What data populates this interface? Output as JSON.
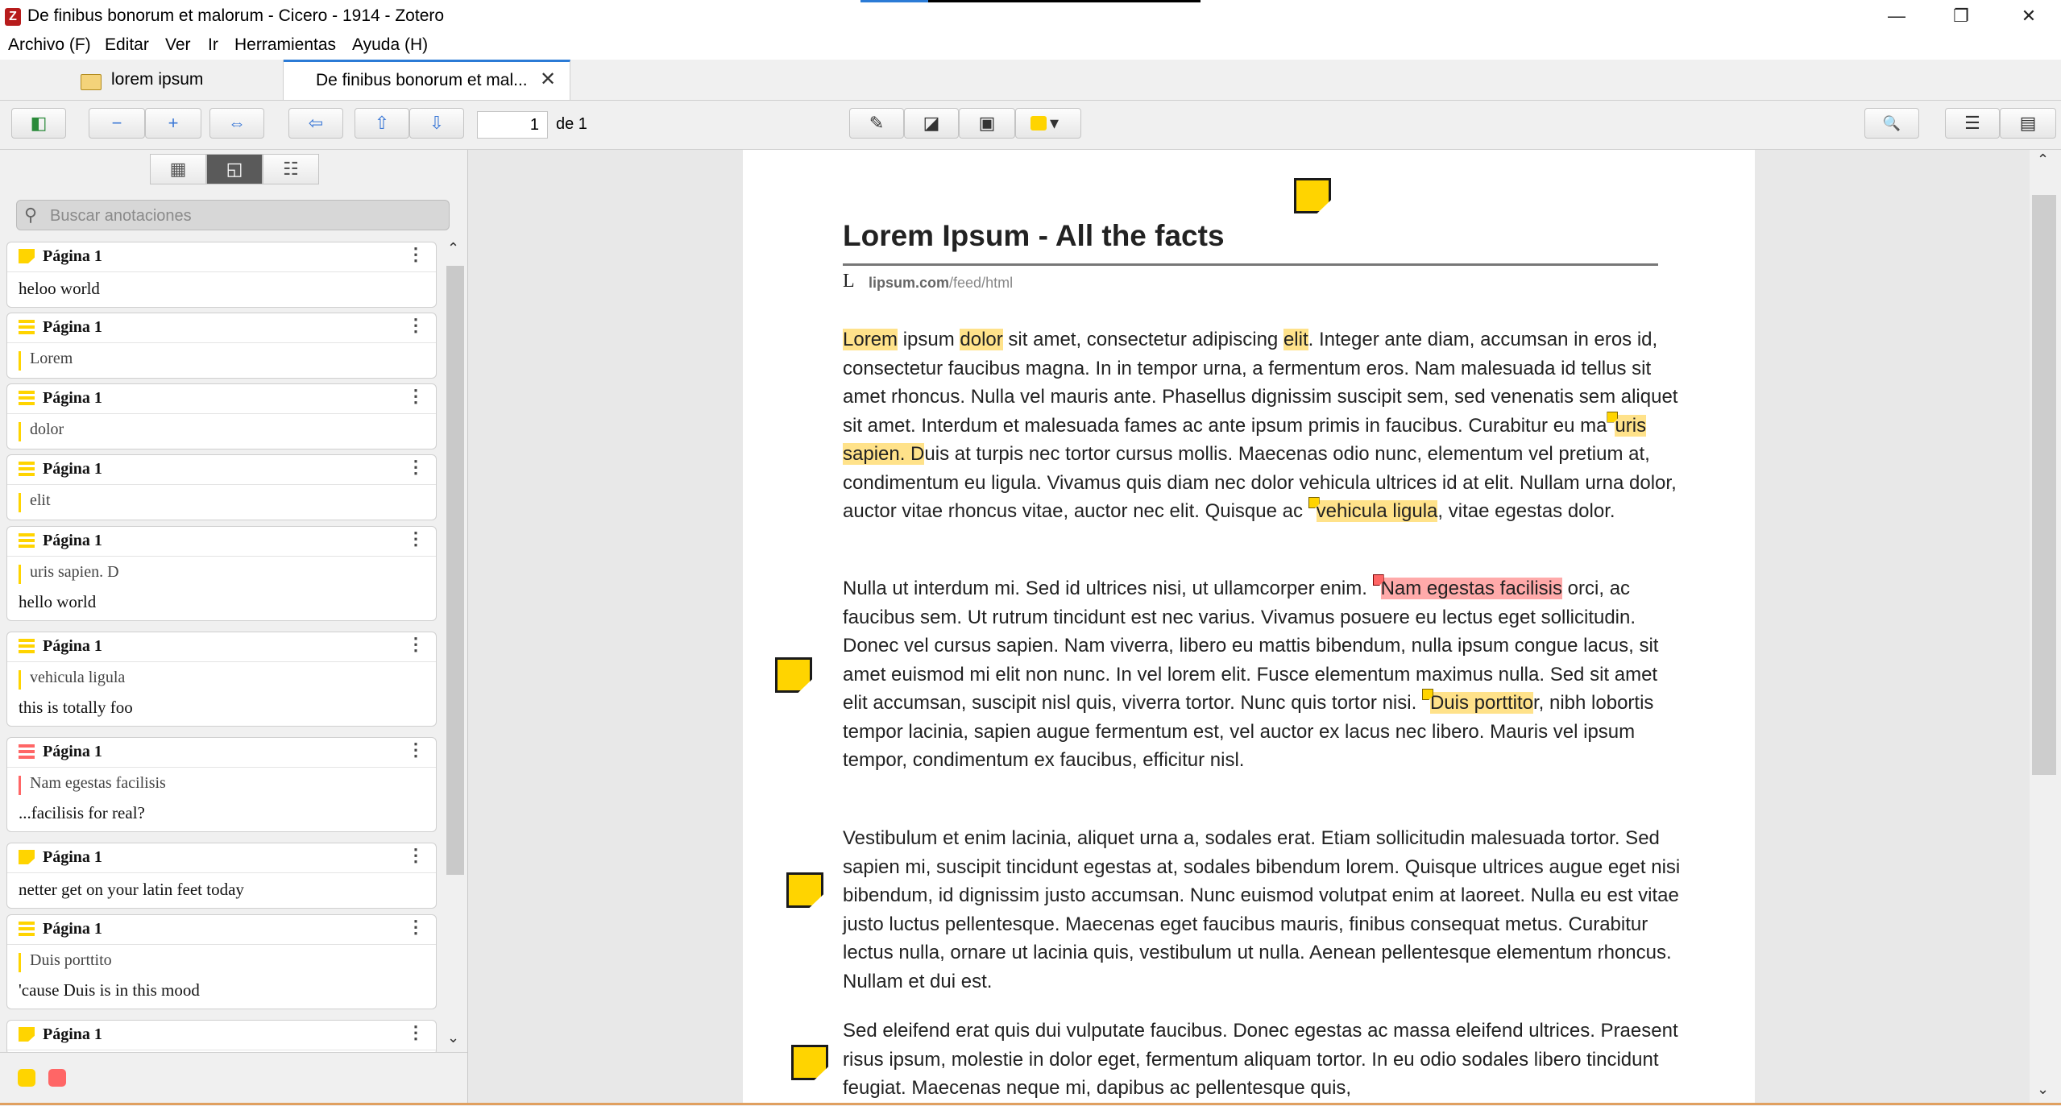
{
  "window": {
    "title": "De finibus bonorum et malorum - Cicero - 1914 - Zotero",
    "app_icon_letter": "Z",
    "minimize_glyph": "—",
    "restore_glyph": "❐",
    "close_glyph": "✕"
  },
  "menu": [
    "Archivo (F)",
    "Editar",
    "Ver",
    "Ir",
    "Herramientas",
    "Ayuda (H)"
  ],
  "tabs": {
    "library_label": "lorem ipsum",
    "reader_label": "De finibus bonorum et mal...",
    "close_glyph": "✕"
  },
  "toolbar": {
    "sidebar_toggle_glyph": "◧",
    "zoom_out_glyph": "−",
    "zoom_in_glyph": "+",
    "fit_width_glyph": "⇔",
    "back_glyph": "⇦",
    "prev_page_glyph": "⇧",
    "next_page_glyph": "⇩",
    "page_value": "1",
    "page_of": "de 1",
    "highlight_glyph": "✎",
    "note_glyph": "◪",
    "area_glyph": "▣",
    "color_dropdown_glyph": "▾",
    "find_glyph": "🔍",
    "outline_glyph": "☰",
    "notes_glyph": "▤",
    "accent_color": "#ffd400"
  },
  "sidebar": {
    "view_buttons": [
      "▦",
      "◱",
      "☷"
    ],
    "search_placeholder": "Buscar anotaciones",
    "search_glyph": "⚲",
    "more_glyph": "⋮",
    "annotations": [
      {
        "type": "note",
        "color": "#ffd400",
        "page": "Página 1",
        "text": "",
        "comment": "heloo world"
      },
      {
        "type": "highlight",
        "color": "#ffd400",
        "page": "Página 1",
        "text": "Lorem",
        "comment": ""
      },
      {
        "type": "highlight",
        "color": "#ffd400",
        "page": "Página 1",
        "text": "dolor",
        "comment": ""
      },
      {
        "type": "highlight",
        "color": "#ffd400",
        "page": "Página 1",
        "text": "elit",
        "comment": ""
      },
      {
        "type": "highlight",
        "color": "#ffd400",
        "page": "Página 1",
        "text": "uris sapien. D",
        "comment": "hello world"
      },
      {
        "type": "highlight",
        "color": "#ffd400",
        "page": "Página 1",
        "text": "vehicula ligula",
        "comment": "this is totally foo"
      },
      {
        "type": "highlight",
        "color": "#ff6666",
        "page": "Página 1",
        "text": "Nam egestas facilisis",
        "comment": "...facilisis for real?"
      },
      {
        "type": "note",
        "color": "#ffd400",
        "page": "Página 1",
        "text": "",
        "comment": "netter get on your latin feet today"
      },
      {
        "type": "highlight",
        "color": "#ffd400",
        "page": "Página 1",
        "text": "Duis porttito",
        "comment": "'cause Duis is in this mood"
      },
      {
        "type": "note",
        "color": "#ffd400",
        "page": "Página 1",
        "text": "",
        "comment": ""
      }
    ],
    "filter_colors": [
      "#ffd400",
      "#ff6666"
    ],
    "scroll_up_glyph": "⌃",
    "scroll_down_glyph": "⌄"
  },
  "document": {
    "title": "Lorem Ipsum - All the facts",
    "source_mark": "L",
    "source_domain": "lipsum.com",
    "source_path": "/feed/html",
    "p1": {
      "h_lorem": "Lorem",
      "t1": " ipsum ",
      "h_dolor": "dolor",
      "t2": " sit amet, consectetur adipiscing ",
      "h_elit": "elit",
      "t3": ". Integer ante diam, accumsan in eros id, consectetur faucibus magna. In in tempor urna, a fermentum eros. Nam malesuada id tellus sit amet rhoncus. Nulla vel mauris ante. Phasellus dignissim suscipit sem, sed venenatis sem aliquet sit amet. Interdum et malesuada fames ac ante ipsum primis in faucibus. Curabitur eu ma",
      "h_uris": "uris sapien. D",
      "t4": "uis at turpis nec tortor cursus mollis. Maecenas odio nunc, elementum vel pretium at, condimentum eu ligula. Vivamus quis diam nec dolor vehicula ultrices id at elit. Nullam urna dolor, auctor vitae rhoncus vitae, auctor nec elit. Quisque ac ",
      "h_vehicula": "vehicula ligula",
      "t5": ", vitae egestas dolor."
    },
    "p2": {
      "t1": "Nulla ut interdum mi. Sed id ultrices nisi, ut ullamcorper enim. ",
      "h_nam": "Nam egestas facilisis",
      "t2": " orci, ac faucibus sem. Ut rutrum tincidunt est nec varius. Vivamus posuere eu lectus eget sollicitudin. Donec vel cursus sapien. Nam viverra, libero eu mattis bibendum, nulla ipsum congue lacus, sit amet euismod mi elit non nunc. In vel lorem elit. Fusce elementum maximus nulla. Sed sit amet elit accumsan, suscipit nisl quis, viverra tortor. Nunc quis tortor nisi. ",
      "h_duis": "Duis porttito",
      "t3": "r, nibh lobortis tempor lacinia, sapien augue fermentum est, vel auctor ex lacus nec libero. Mauris vel ipsum tempor, condimentum ex faucibus, efficitur nisl."
    },
    "p3": "Vestibulum et enim lacinia, aliquet urna a, sodales erat. Etiam sollicitudin malesuada tortor. Sed sapien mi, suscipit tincidunt egestas at, sodales bibendum lorem. Quisque ultrices augue eget nisi bibendum, id dignissim justo accumsan. Nunc euismod volutpat enim at laoreet. Nulla eu est vitae justo luctus pellentesque. Maecenas eget faucibus mauris, finibus consequat metus. Curabitur lectus nulla, ornare ut lacinia quis, vestibulum ut nulla. Aenean pellentesque elementum rhoncus. Nullam et dui est.",
    "p4": "Sed eleifend erat quis dui vulputate faucibus. Donec egestas ac massa eleifend ultrices. Praesent risus ipsum, molestie in dolor eget, fermentum aliquam tortor. In eu odio sodales libero tincidunt feugiat. Maecenas neque mi, dapibus ac pellentesque quis,",
    "highlight_color": "#ffe28a",
    "red_highlight_color": "#ffaaaa"
  },
  "doc_scroll": {
    "up_glyph": "⌃",
    "down_glyph": "⌄"
  }
}
